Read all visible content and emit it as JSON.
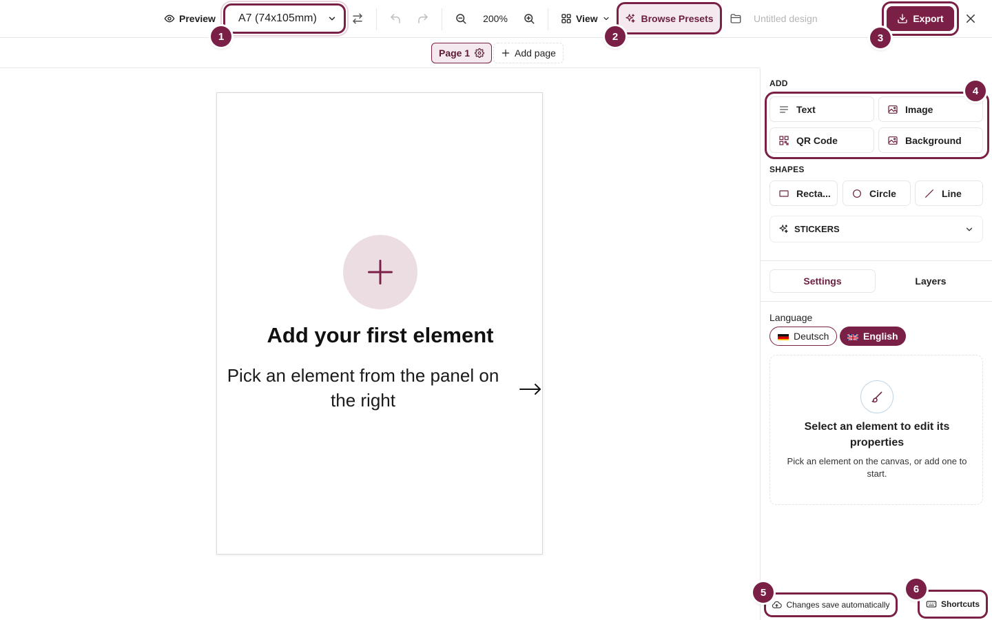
{
  "toolbar": {
    "preview_label": "Preview",
    "size_value": "A7 (74x105mm)",
    "zoom_level": "200%",
    "view_label": "View",
    "presets_label": "Browse Presets",
    "design_name": "Untitled design",
    "export_label": "Export"
  },
  "pagebar": {
    "page_label": "Page 1",
    "add_page_label": "Add page"
  },
  "canvas": {
    "empty_title": "Add your first element",
    "empty_subtitle": "Pick an element from the panel on the right"
  },
  "panel": {
    "add_label": "ADD",
    "add_items": [
      "Text",
      "Image",
      "QR Code",
      "Background"
    ],
    "shapes_label": "SHAPES",
    "shape_items": [
      "Recta...",
      "Circle",
      "Line"
    ],
    "stickers_label": "STICKERS",
    "tabs": [
      "Settings",
      "Layers"
    ],
    "language_label": "Language",
    "languages": [
      "Deutsch",
      "English"
    ],
    "selected_language": "English",
    "empty_title": "Select an element to edit its properties",
    "empty_subtitle": "Pick an element on the canvas, or add one to start."
  },
  "footer": {
    "autosave_label": "Changes save automatically",
    "shortcuts_label": "Shortcuts"
  },
  "badges": [
    "1",
    "2",
    "3",
    "4",
    "5",
    "6"
  ],
  "colors": {
    "accent": "#7a1f45",
    "accent_tint": "#f3e9ee",
    "plus_circle": "#ecdde3",
    "muted_text": "#b5b5b5"
  }
}
